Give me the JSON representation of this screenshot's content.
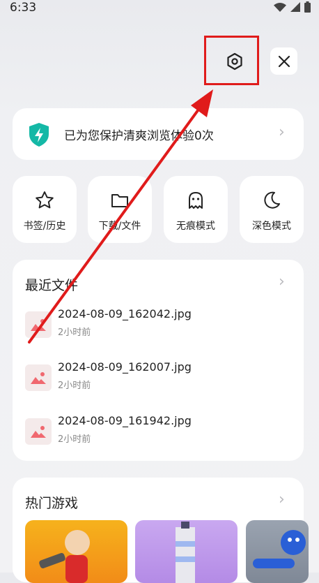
{
  "status_bar": {
    "time": "6:33"
  },
  "protect": {
    "text": "已为您保护清爽浏览体验0次"
  },
  "quick_actions": [
    {
      "label": "书签/历史",
      "icon": "star-icon"
    },
    {
      "label": "下载/文件",
      "icon": "folder-icon"
    },
    {
      "label": "无痕模式",
      "icon": "ghost-icon"
    },
    {
      "label": "深色模式",
      "icon": "moon-icon"
    }
  ],
  "recent": {
    "title": "最近文件",
    "files": [
      {
        "name": "2024-08-09_162042.jpg",
        "time": "2小时前"
      },
      {
        "name": "2024-08-09_162007.jpg",
        "time": "2小时前"
      },
      {
        "name": "2024-08-09_161942.jpg",
        "time": "2小时前"
      }
    ]
  },
  "games": {
    "title": "热门游戏"
  },
  "colors": {
    "accent": "#14b8a6",
    "highlight": "#e01b1b",
    "image_icon": "#f0686f"
  }
}
